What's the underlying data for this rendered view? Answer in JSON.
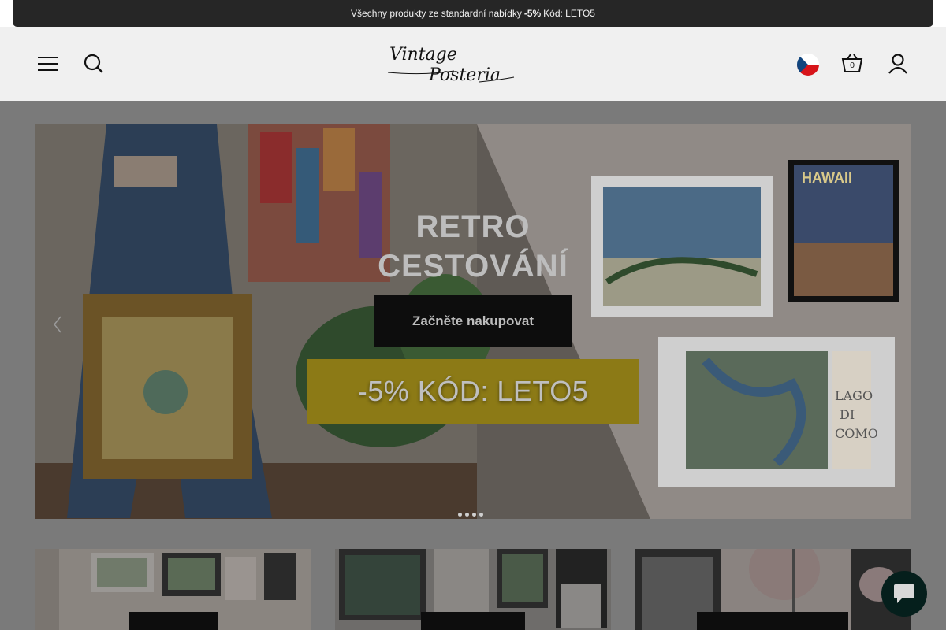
{
  "announcement": {
    "text_before": "Všechny produkty ze standardní nabídky",
    "discount": "-5%",
    "text_after": "Kód: LETO5"
  },
  "header": {
    "logo_line1": "Vintage",
    "logo_line2": "Posteria",
    "cart_count": "0",
    "language": "CZ"
  },
  "hero": {
    "title_line1": "RETRO",
    "title_line2": "CESTOVÁNÍ",
    "cta_label": "Začněte nakupovat",
    "promo_label": "-5% KÓD: LETO5",
    "slide_count": 4
  },
  "colors": {
    "accent_yellow": "#8c7a16",
    "dark": "#0d0d0d",
    "chat": "#051f1c"
  }
}
